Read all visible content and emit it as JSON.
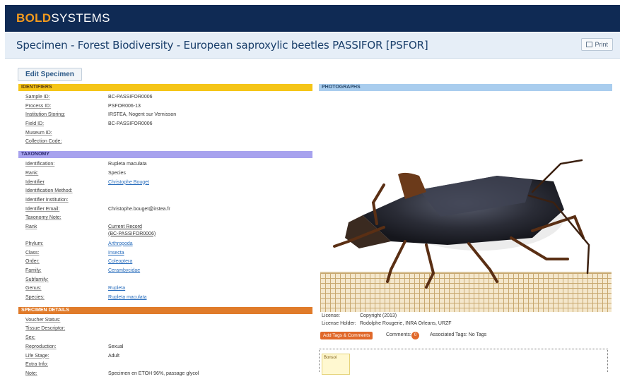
{
  "header": {
    "logo_bold": "BOLD",
    "logo_systems": "SYSTEMS",
    "page_title": "Specimen - Forest Biodiversity - European saproxylic beetles PASSIFOR [PSFOR]",
    "print_label": "Print",
    "edit_label": "Edit Specimen"
  },
  "identifiers": {
    "heading": "IDENTIFIERS",
    "rows": [
      {
        "label": "Sample ID:",
        "value": "BC-PASSIFOR0006"
      },
      {
        "label": "Process ID:",
        "value": "PSFOR006-13"
      },
      {
        "label": "Institution Storing:",
        "value": "IRSTEA, Nogent sur Vernisson"
      },
      {
        "label": "Field ID:",
        "value": "BC-PASSIFOR0006"
      },
      {
        "label": "Museum ID:",
        "value": ""
      },
      {
        "label": "Collection Code:",
        "value": ""
      }
    ]
  },
  "taxonomy": {
    "heading": "TAXONOMY",
    "rows": [
      {
        "label": "Identification:",
        "value": "Rupleta maculata"
      },
      {
        "label": "Rank:",
        "value": "Species"
      },
      {
        "label": "Identifier",
        "value": "Christophe Bouget"
      },
      {
        "label": "Identification Method:",
        "value": ""
      },
      {
        "label": "Identifier Institution:",
        "value": ""
      },
      {
        "label": "Identifier Email:",
        "value": "Christophe.bouget@irstea.fr"
      },
      {
        "label": "Taxonomy Note:",
        "value": ""
      }
    ],
    "rank_label": "Rank",
    "rank_line1": "Current Record",
    "rank_line2": "(BC-PASSIFOR0006)",
    "ranks": [
      {
        "label": "Phylum:",
        "value": "Arthropoda"
      },
      {
        "label": "Class:",
        "value": "Insecta"
      },
      {
        "label": "Order:",
        "value": "Coleoptera"
      },
      {
        "label": "Family:",
        "value": "Cerambycidae"
      },
      {
        "label": "Subfamily:",
        "value": ""
      },
      {
        "label": "Genus:",
        "value": "Rupleta"
      },
      {
        "label": "Species:",
        "value": "Rupleta maculata"
      }
    ]
  },
  "specimen": {
    "heading": "SPECIMEN DETAILS",
    "rows": [
      {
        "label": "Voucher Status:",
        "value": ""
      },
      {
        "label": "Tissue Descriptor:",
        "value": ""
      },
      {
        "label": "Sex:",
        "value": ""
      },
      {
        "label": "Reproduction:",
        "value": "Sexual"
      },
      {
        "label": "Life Stage:",
        "value": "Adult"
      },
      {
        "label": "Extra Info:",
        "value": ""
      },
      {
        "label": "Note:",
        "value": "Specimen en ETOH 96%, passage glycol"
      }
    ]
  },
  "photographs": {
    "heading": "PHOTOGRAPHS",
    "license_label": "License:",
    "license_value": "Copyright (2013)",
    "holder_label": "License Holder:",
    "holder_value": "Rodolphe Rougerie, INRA Orleans, URZF",
    "add_tags_label": "Add Tags & Comments",
    "comments_label": "Comments:",
    "comments_count": "0",
    "associated_tags": "Associated Tags: No Tags",
    "tag_note": "Bonsoi"
  },
  "colors": {
    "topbar": "#0f2a54",
    "logo_accent": "#f39a1d",
    "identifiers": "#f5c518",
    "taxonomy": "#a7a2ee",
    "specimen": "#e07b2a",
    "photographs": "#a9cdee"
  }
}
